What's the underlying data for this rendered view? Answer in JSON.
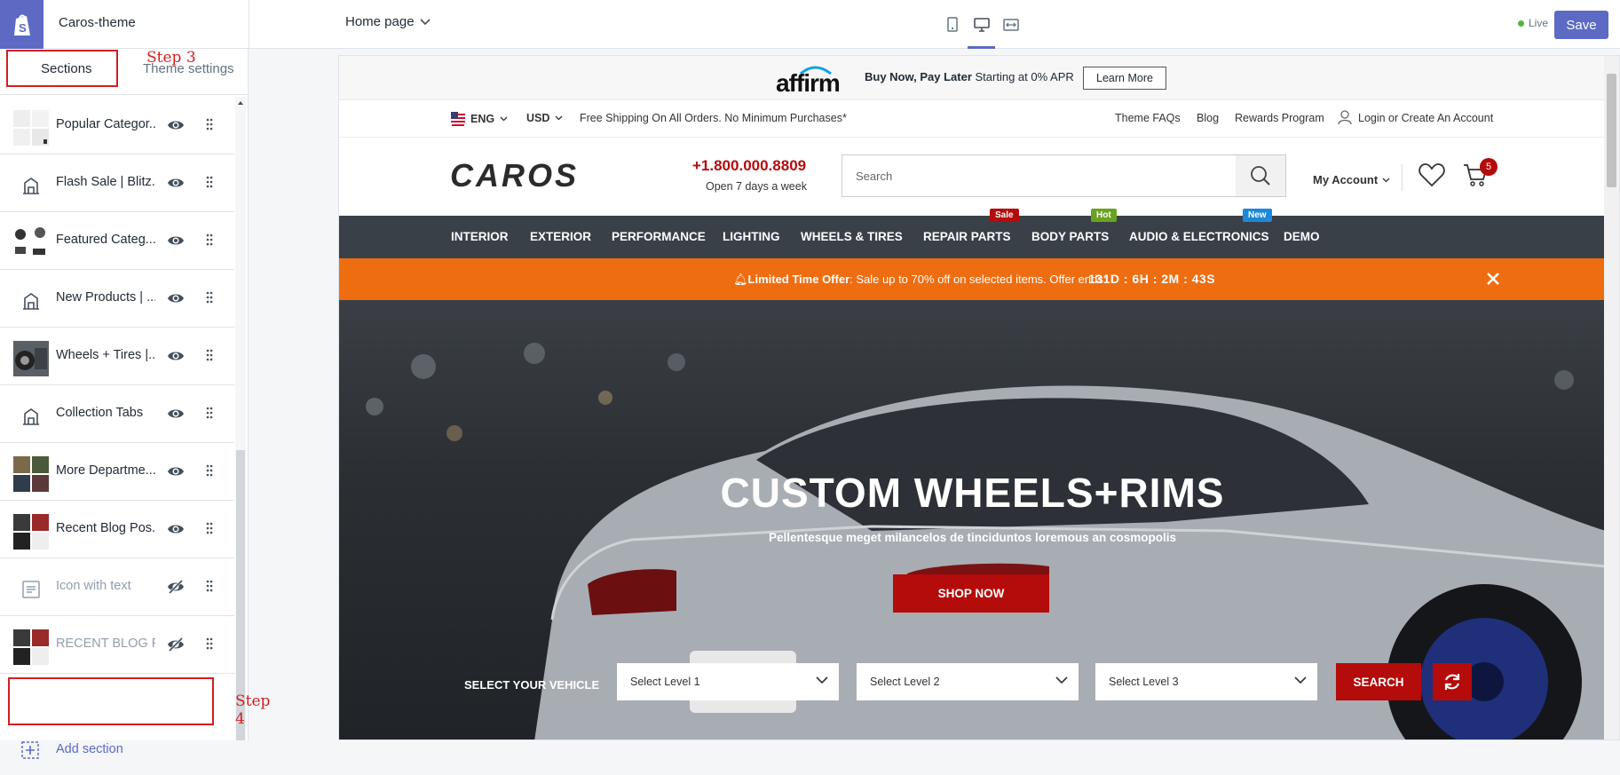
{
  "app": {
    "theme_name": "Caros-theme",
    "page_select": "Home page",
    "live_label": "Live",
    "save_label": "Save"
  },
  "sidebar": {
    "tabs": [
      {
        "label": "Sections"
      },
      {
        "label": "Theme settings"
      }
    ],
    "step3": "Step 3",
    "step4": "Step 4",
    "items": [
      {
        "label": "Popular Categor...",
        "visible": true
      },
      {
        "label": "Flash Sale | Blitz...",
        "visible": true
      },
      {
        "label": "Featured Categ...",
        "visible": true
      },
      {
        "label": "New Products | ...",
        "visible": true
      },
      {
        "label": "Wheels + Tires |...",
        "visible": true
      },
      {
        "label": "Collection Tabs",
        "visible": true
      },
      {
        "label": "More Departme...",
        "visible": true
      },
      {
        "label": "Recent Blog Pos...",
        "visible": true
      },
      {
        "label": "Icon with text",
        "visible": false
      },
      {
        "label": "RECENT BLOG P...",
        "visible": false
      }
    ],
    "add_section": "Add section"
  },
  "preview": {
    "affirm": {
      "logo": "affirm",
      "bold": "Buy Now, Pay Later",
      "text": " Starting at 0% APR",
      "button": "Learn More"
    },
    "util": {
      "lang": "ENG",
      "currency": "USD",
      "shipping": "Free Shipping On All Orders. No Minimum Purchases*",
      "faq": "Theme FAQs",
      "blog": "Blog",
      "rewards": "Rewards Program",
      "login": "Login or Create An Account"
    },
    "header": {
      "brand": "CAROS",
      "phone": "+1.800.000.8809",
      "hours": "Open 7 days a week",
      "search_placeholder": "Search",
      "account": "My Account",
      "cart_count": "5"
    },
    "nav": [
      {
        "label": "INTERIOR"
      },
      {
        "label": "EXTERIOR"
      },
      {
        "label": "PERFORMANCE"
      },
      {
        "label": "LIGHTING"
      },
      {
        "label": "WHEELS & TIRES"
      },
      {
        "label": "REPAIR PARTS",
        "badge": "Sale",
        "badge_color": "#b40b0b"
      },
      {
        "label": "BODY PARTS",
        "badge": "Hot",
        "badge_color": "#6aa122"
      },
      {
        "label": "AUDIO & ELECTRONICS",
        "badge": "New",
        "badge_color": "#1e88d8"
      },
      {
        "label": "DEMO"
      }
    ],
    "offer": {
      "bold": "Limited Time Offer",
      "text": ": Sale up to 70% off on selected items. Offer ends:",
      "countdown": "131D : 6H : 2M : 43S"
    },
    "hero": {
      "title": "CUSTOM WHEELS+RIMS",
      "subtitle": "Pellentesque meget milancelos de tinciduntos loremous an cosmopolis",
      "button": "SHOP NOW"
    },
    "vehicle": {
      "label": "SELECT YOUR VEHICLE",
      "level1": "Select Level 1",
      "level2": "Select Level 2",
      "level3": "Select Level 3",
      "search": "SEARCH"
    }
  },
  "colors": {
    "accent": "#5c6ac4",
    "brand_red": "#b40b0b",
    "offer_orange": "#ef6d11",
    "nav_bg": "#3a4048",
    "step_red": "#d21f1f"
  }
}
